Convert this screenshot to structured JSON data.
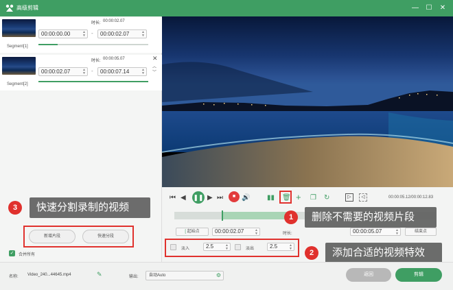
{
  "window": {
    "title": "高级剪辑",
    "minimize_glyph": "—",
    "maximize_glyph": "☐",
    "close_glyph": "✕"
  },
  "segments": [
    {
      "label": "Segment[1]",
      "duration_label": "时长:",
      "duration": "00:00:02.07",
      "start": "00:00:00.00",
      "end": "00:00:02.07"
    },
    {
      "label": "Segment[2]",
      "duration_label": "时长:",
      "duration": "00:00:05.07",
      "start": "00:00:02.07",
      "end": "00:00:07.14"
    }
  ],
  "left_actions": {
    "new_segment": "新增片段",
    "quick_split": "快速分段",
    "merge_all": "合并所有"
  },
  "callouts": {
    "c1": {
      "number": "1",
      "text": "删除不需要的视频片段"
    },
    "c2": {
      "number": "2",
      "text": "添加合适的视频特效"
    },
    "c3": {
      "number": "3",
      "text": "快速分割录制的视频"
    }
  },
  "player": {
    "time_display": "00:00:05.12/00:00:12.83"
  },
  "trim": {
    "start_btn": "起始点",
    "start_value": "00:00:02.07",
    "duration_label": "时长:",
    "duration_value": "00:00:05.07",
    "end_btn": "结束点"
  },
  "effects": {
    "fade_in_label": "淡入",
    "fade_in_value": "2.5",
    "fade_out_label": "淡出",
    "fade_out_value": "2.5"
  },
  "footer": {
    "name_label": "名称:",
    "name_value": "Video_240...44645.mp4",
    "output_label": "输出:",
    "output_value": "自动Auto",
    "back_button": "返回",
    "edit_button": "剪辑"
  },
  "colors": {
    "brand": "#3f9e63",
    "callout_red": "#e0312d",
    "stop_red": "#e23c3c"
  }
}
